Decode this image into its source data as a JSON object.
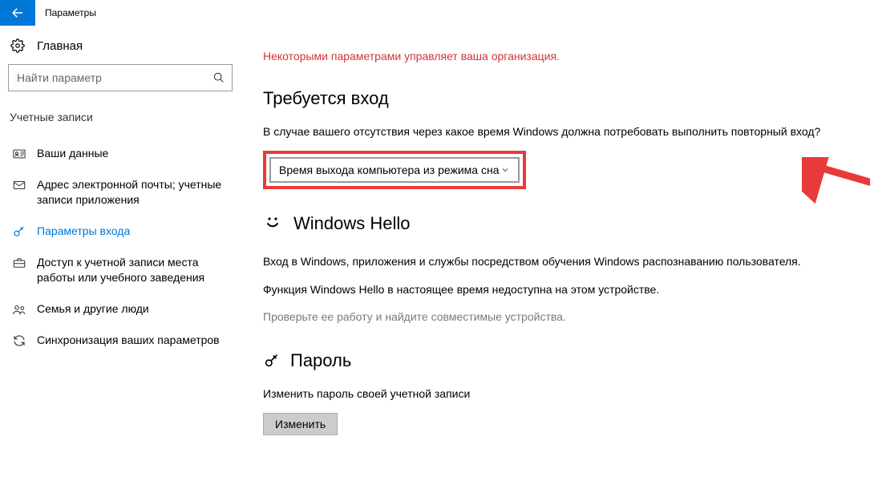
{
  "titlebar": {
    "title": "Параметры"
  },
  "sidebar": {
    "home": "Главная",
    "search_placeholder": "Найти параметр",
    "section": "Учетные записи",
    "items": [
      {
        "label": "Ваши данные"
      },
      {
        "label": "Адрес электронной почты; учетные записи приложения"
      },
      {
        "label": "Параметры входа"
      },
      {
        "label": "Доступ к учетной записи места работы или учебного заведения"
      },
      {
        "label": "Семья и другие люди"
      },
      {
        "label": "Синхронизация ваших параметров"
      }
    ]
  },
  "main": {
    "org_notice": "Некоторыми параметрами управляет ваша организация.",
    "signin": {
      "heading": "Требуется вход",
      "desc": "В случае вашего отсутствия через какое время Windows должна потребовать выполнить повторный вход?",
      "dropdown_value": "Время выхода компьютера из режима сна"
    },
    "hello": {
      "heading": "Windows Hello",
      "desc1": "Вход в Windows, приложения и службы посредством обучения Windows распознаванию пользователя.",
      "desc2": "Функция Windows Hello в настоящее время недоступна на этом устройстве.",
      "desc3": "Проверьте ее работу и найдите совместимые устройства."
    },
    "password": {
      "heading": "Пароль",
      "desc": "Изменить пароль своей учетной записи",
      "button": "Изменить"
    }
  }
}
